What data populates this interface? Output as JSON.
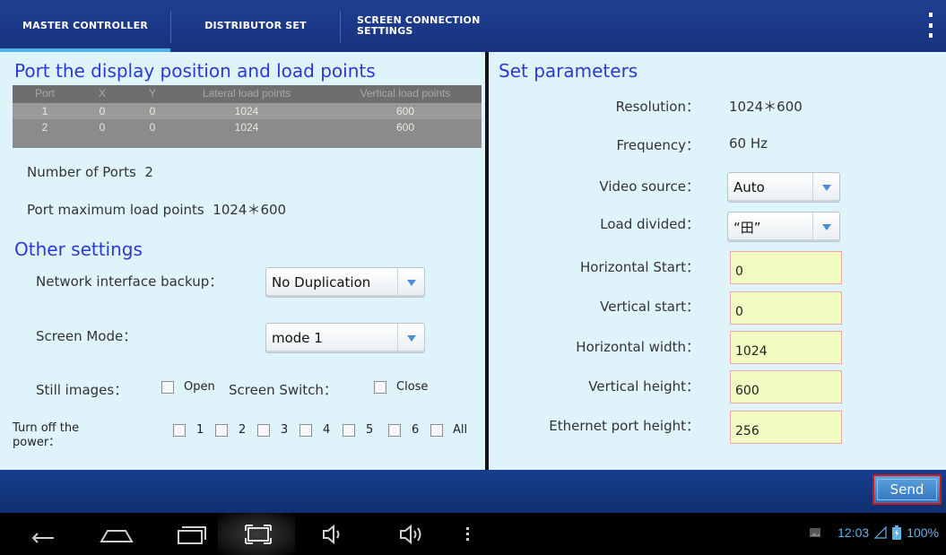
{
  "tabs": [
    {
      "label": "MASTER CONTROLLER"
    },
    {
      "label": "DISTRIBUTOR SET"
    },
    {
      "label_line1": "SCREEN CONNECTION",
      "label_line2": "SETTINGS"
    }
  ],
  "left": {
    "title": "Port the display position and load points",
    "table": {
      "headers": [
        "Port",
        "X",
        "Y",
        "Lateral load points",
        "Vertical load points"
      ],
      "rows": [
        [
          "1",
          "0",
          "0",
          "1024",
          "600"
        ],
        [
          "2",
          "0",
          "0",
          "1024",
          "600"
        ]
      ]
    },
    "ports_label": "Number of Ports",
    "ports_value": "2",
    "max_load_label": "Port maximum load points",
    "max_load_value": "1024＊600",
    "other_title": "Other settings",
    "net_backup_label": "Network interface backup：",
    "net_backup_value": "No Duplication",
    "screen_mode_label": "Screen Mode：",
    "screen_mode_value": "mode 1",
    "still_images_label": "Still images：",
    "still_open_label": "Open",
    "screen_switch_label": "Screen Switch：",
    "screen_close_label": "Close",
    "power_label_line1": "Turn off the",
    "power_label_line2": "power：",
    "power_options": [
      "1",
      "2",
      "3",
      "4",
      "5",
      "6",
      "All"
    ]
  },
  "right": {
    "title": "Set parameters",
    "resolution_label": "Resolution：",
    "resolution_value": "1024＊600",
    "frequency_label": "Frequency：",
    "frequency_value": "60 Hz",
    "video_source_label": "Video source：",
    "video_source_value": "Auto",
    "load_divided_label": "Load divided：",
    "load_divided_value": "“田”",
    "h_start_label": "Horizontal Start：",
    "h_start_value": "0",
    "v_start_label": "Vertical start：",
    "v_start_value": "0",
    "h_width_label": "Horizontal width：",
    "h_width_value": "1024",
    "v_height_label": "Vertical height：",
    "v_height_value": "600",
    "eth_height_label": "Ethernet port height：",
    "eth_height_value": "256"
  },
  "action": {
    "send_label": "Send"
  },
  "status": {
    "time": "12:03",
    "battery": "100%"
  },
  "colors": {
    "tabbar": "#1f3f92",
    "accent": "#4eb6e6",
    "content_bg": "#dff3fb",
    "section_title": "#2b39d6",
    "field_bg": "#f2fbc2",
    "send_border": "#d61515"
  }
}
